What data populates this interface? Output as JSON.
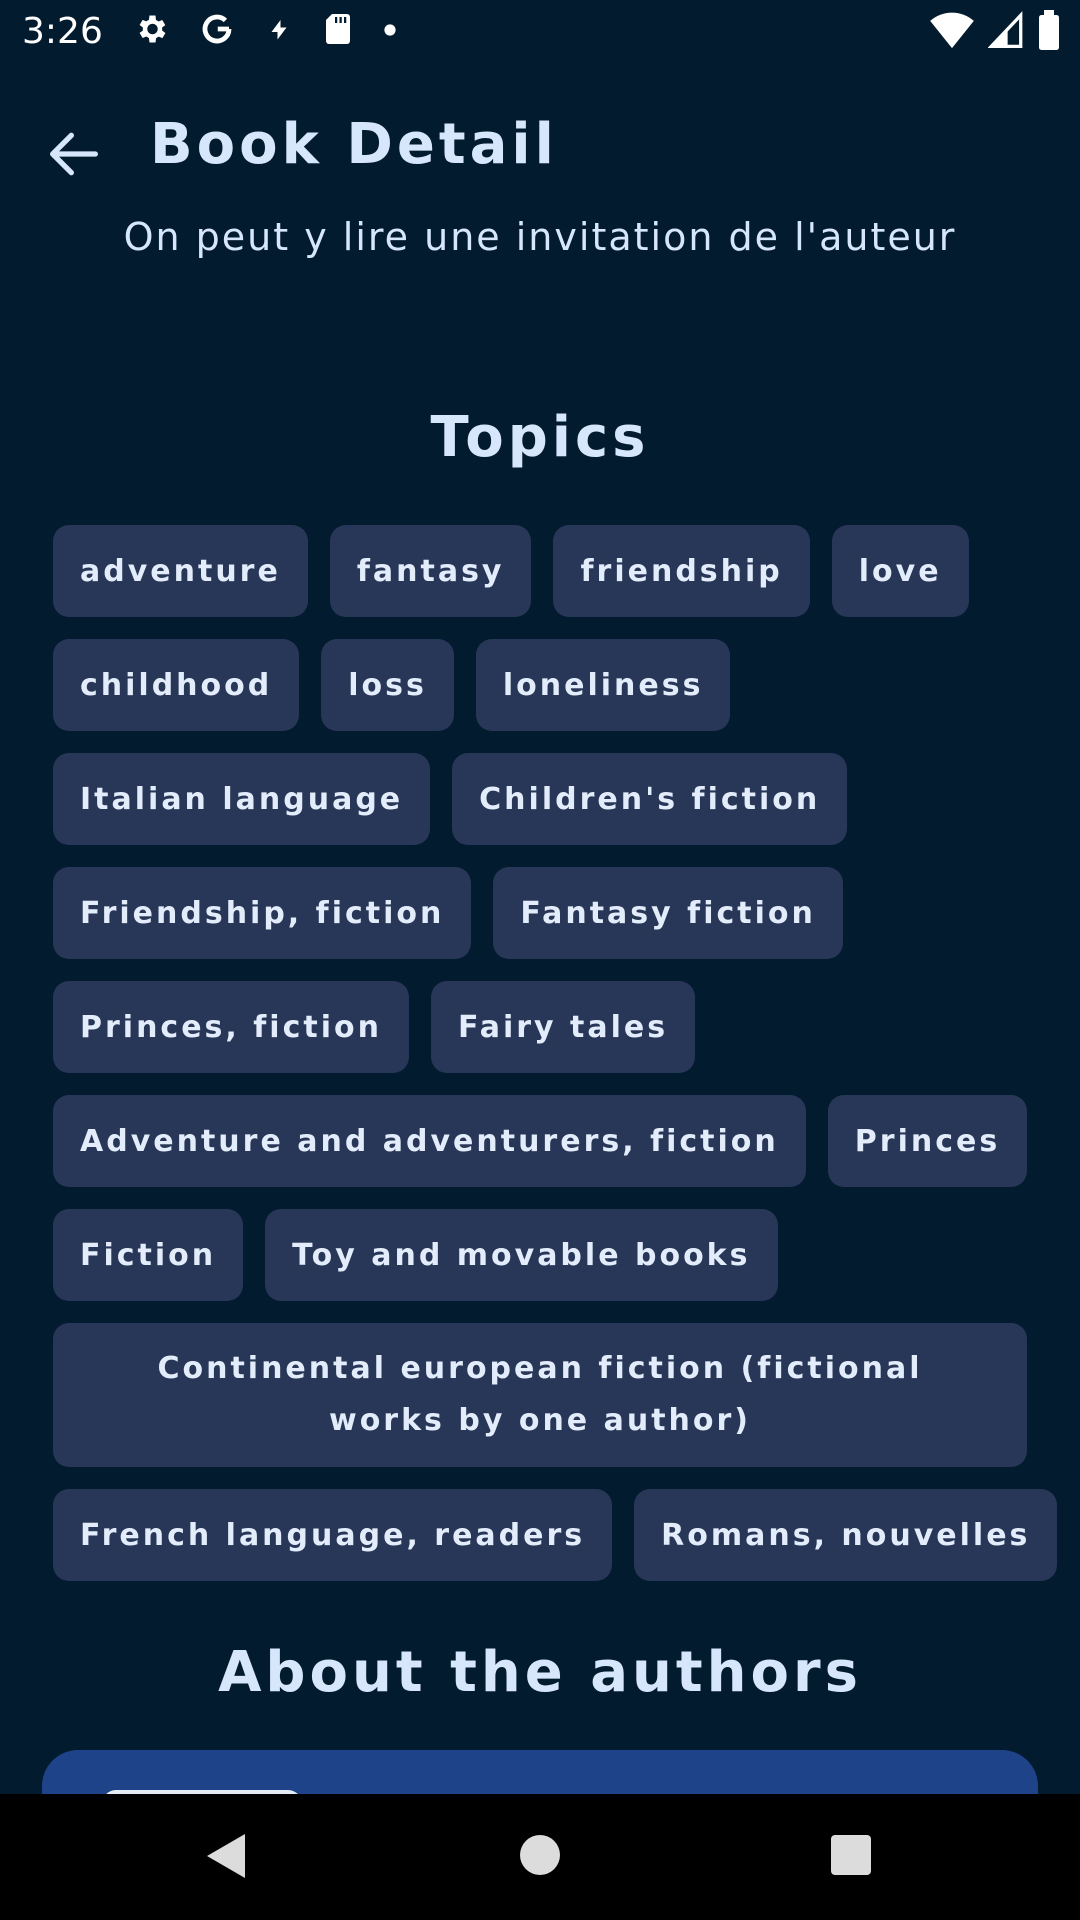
{
  "status_bar": {
    "time": "3:26"
  },
  "app_bar": {
    "title": "Book Detail",
    "back_icon": "arrow-back-icon"
  },
  "description": {
    "visible_line": "On peut y lire une invitation de l'auteur"
  },
  "topics": {
    "title": "Topics",
    "rows": [
      [
        "adventure",
        "fantasy",
        "friendship",
        "love"
      ],
      [
        "childhood",
        "loss",
        "loneliness"
      ],
      [
        "Italian language",
        "Children's fiction"
      ],
      [
        "Friendship, fiction",
        "Fantasy fiction"
      ],
      [
        "Princes, fiction",
        "Fairy tales"
      ],
      [
        "Adventure and adventurers, fiction",
        "Princes"
      ],
      [
        "Fiction",
        "Toy and movable books"
      ],
      [
        "Continental european fiction (fictional works by one author)"
      ],
      [
        "French language, readers",
        "Romans, nouvelles"
      ]
    ]
  },
  "authors": {
    "title": "About the authors"
  },
  "colors": {
    "background": "#031b2f",
    "chip": "#283657",
    "text": "#d6e6fb",
    "author_card": "#1f4389"
  }
}
